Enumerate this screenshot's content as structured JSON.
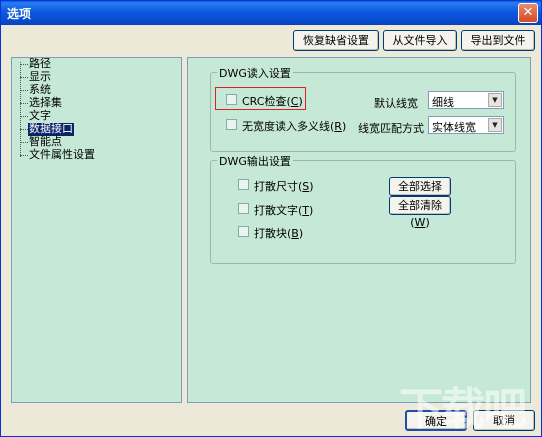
{
  "window": {
    "title": "选项",
    "close_glyph": "✕"
  },
  "top_buttons": {
    "restore_defaults": "恢复缺省设置",
    "import_from_file": "从文件导入",
    "export_to_file": "导出到文件"
  },
  "tree": {
    "items": [
      {
        "label": "路径",
        "selected": false
      },
      {
        "label": "显示",
        "selected": false
      },
      {
        "label": "系统",
        "selected": false
      },
      {
        "label": "选择集",
        "selected": false
      },
      {
        "label": "文字",
        "selected": false
      },
      {
        "label": "数据接口",
        "selected": true
      },
      {
        "label": "智能点",
        "selected": false
      },
      {
        "label": "文件属性设置",
        "selected": false
      }
    ]
  },
  "dwg_read": {
    "group_title": "DWG读入设置",
    "crc_check": {
      "text": "CRC检查(",
      "hotkey": "C",
      "suffix": ")",
      "checked": false
    },
    "no_width_polyline": {
      "text": "无宽度读入多义线(",
      "hotkey": "R",
      "suffix": ")",
      "checked": false
    },
    "default_linewidth_label": "默认线宽",
    "default_linewidth_value": "细线",
    "linewidth_match_label": "线宽匹配方式",
    "linewidth_match_value": "实体线宽"
  },
  "dwg_write": {
    "group_title": "DWG输出设置",
    "explode_dimension": {
      "text": "打散尺寸(",
      "hotkey": "S",
      "suffix": ")",
      "checked": false
    },
    "explode_text": {
      "text": "打散文字(",
      "hotkey": "T",
      "suffix": ")",
      "checked": false
    },
    "explode_block": {
      "text": "打散块(",
      "hotkey": "B",
      "suffix": ")",
      "checked": false
    },
    "select_all": {
      "text": "全部选择(",
      "hotkey": "A",
      "suffix": ")"
    },
    "clear_all": {
      "text": "全部清除(",
      "hotkey": "W",
      "suffix": ")"
    }
  },
  "footer": {
    "ok": "确定",
    "cancel": "取消"
  },
  "watermark": "下载吧",
  "colors": {
    "panel_bg": "#c6e8d6",
    "titlebar": "#0b5ae0",
    "selection": "#0a246a",
    "highlight_box": "#e02020"
  }
}
